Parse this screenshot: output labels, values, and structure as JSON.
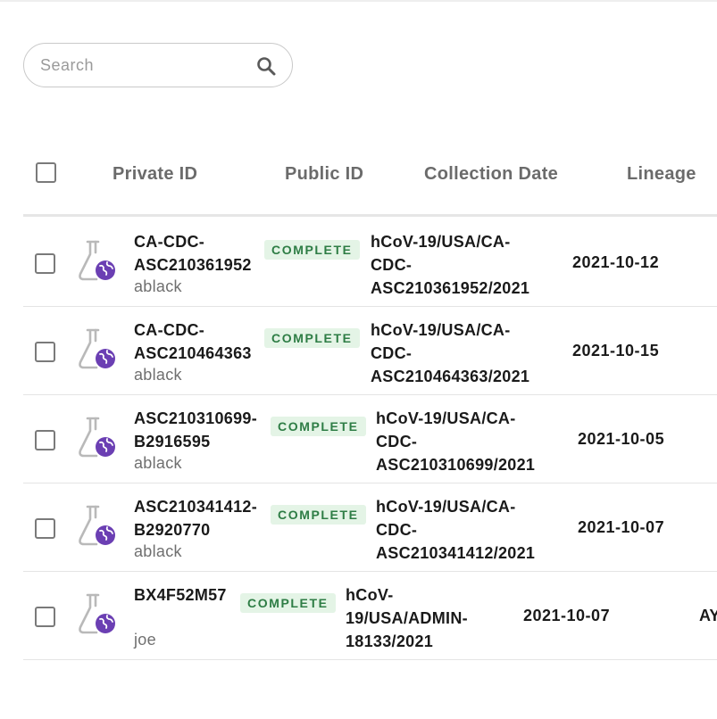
{
  "search": {
    "placeholder": "Search",
    "value": ""
  },
  "table": {
    "columns": [
      "Private ID",
      "Public ID",
      "Collection Date",
      "Lineage"
    ],
    "rows": [
      {
        "private_id": "CA-CDC-ASC210361952",
        "uploader": "ablack",
        "status": "COMPLETE",
        "public_id": "hCoV-19/USA/CA-CDC-ASC210361952/2021",
        "collection_date": "2021-10-12",
        "lineage": ""
      },
      {
        "private_id": "CA-CDC-ASC210464363",
        "uploader": "ablack",
        "status": "COMPLETE",
        "public_id": "hCoV-19/USA/CA-CDC-ASC210464363/2021",
        "collection_date": "2021-10-15",
        "lineage": ""
      },
      {
        "private_id": "ASC210310699-B2916595",
        "uploader": "ablack",
        "status": "COMPLETE",
        "public_id": "hCoV-19/USA/CA-CDC-ASC210310699/2021",
        "collection_date": "2021-10-05",
        "lineage": ""
      },
      {
        "private_id": "ASC210341412-B2920770",
        "uploader": "ablack",
        "status": "COMPLETE",
        "public_id": "hCoV-19/USA/CA-CDC-ASC210341412/2021",
        "collection_date": "2021-10-07",
        "lineage": ""
      },
      {
        "private_id": "BX4F52M57",
        "uploader": "joe",
        "status": "COMPLETE",
        "public_id": "hCoV-19/USA/ADMIN-18133/2021",
        "collection_date": "2021-10-07",
        "lineage": "AY"
      }
    ]
  },
  "icons": {
    "search": "search-icon",
    "sample": "flask-globe-icon"
  },
  "colors": {
    "badge_bg": "#e4f4e6",
    "badge_text": "#2e7d45",
    "globe": "#6b3fb3"
  }
}
